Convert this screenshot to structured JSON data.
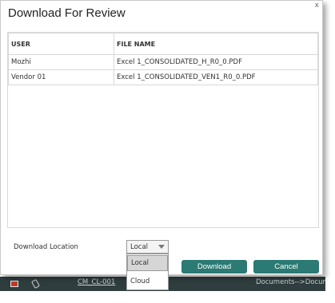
{
  "dialog": {
    "title": "Download For Review",
    "close_glyph": "x"
  },
  "table": {
    "columns": [
      "USER",
      "FILE NAME"
    ],
    "rows": [
      {
        "user": "Mozhi",
        "file": "Excel 1_CONSOLIDATED_H_R0_0.PDF"
      },
      {
        "user": "Vendor 01",
        "file": "Excel 1_CONSOLIDATED_VEN1_R0_0.PDF"
      }
    ]
  },
  "download_location": {
    "label": "Download Location",
    "selected": "Local",
    "options": [
      "Local",
      "Cloud"
    ]
  },
  "buttons": {
    "download": "Download",
    "cancel": "Cancel"
  },
  "background": {
    "link": "CM_CL-001",
    "breadcrumb": "Documents-->Documents"
  },
  "colors": {
    "button_bg": "#2b7a74",
    "app_bar_bg": "#2f3d3e"
  }
}
